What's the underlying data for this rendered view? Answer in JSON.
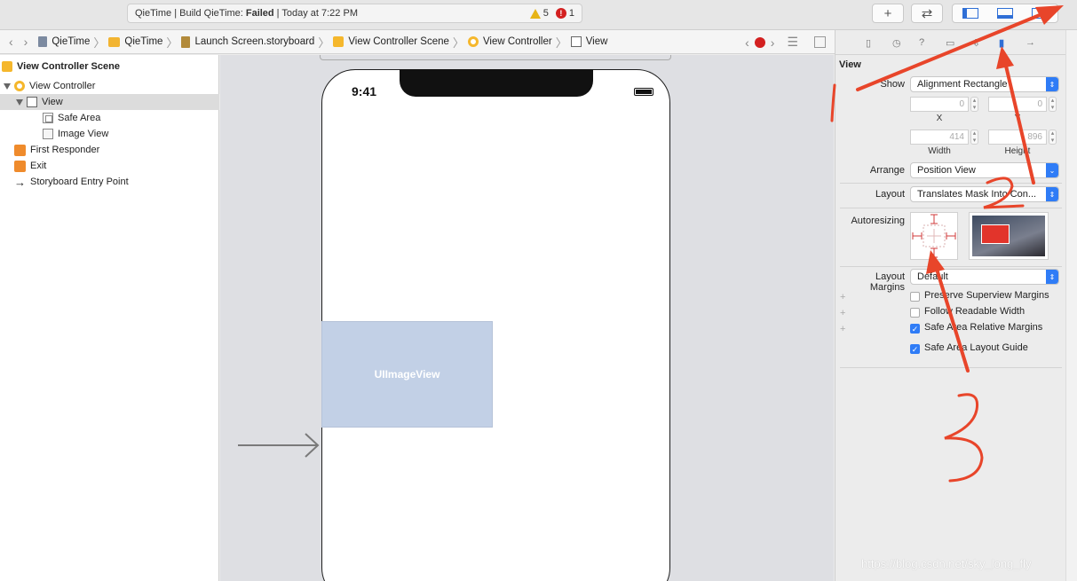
{
  "toolbar": {
    "status_prefix": "QieTime | Build QieTime:",
    "status_state": "Failed",
    "status_suffix": "| Today at 7:22 PM",
    "warning_count": "5",
    "error_count": "1",
    "add_label": "+",
    "swap_label": "⇄"
  },
  "jumpbar": {
    "crumbs": [
      "QieTime",
      "QieTime",
      "Launch Screen.storyboard",
      "View Controller Scene",
      "View Controller",
      "View"
    ]
  },
  "outline": {
    "scene": "View Controller Scene",
    "items": [
      "View Controller",
      "View",
      "Safe Area",
      "Image View",
      "First Responder",
      "Exit",
      "Storyboard Entry Point"
    ]
  },
  "canvas": {
    "time": "9:41",
    "image_view_label": "UIImageView"
  },
  "inspector": {
    "section": "View",
    "show_label": "Show",
    "show_value": "Alignment Rectangle",
    "x_value": "0",
    "y_value": "0",
    "x_label": "X",
    "y_label": "Y",
    "width_value": "414",
    "height_value": "896",
    "width_label": "Width",
    "height_label": "Height",
    "arrange_label": "Arrange",
    "arrange_value": "Position View",
    "layout_label": "Layout",
    "layout_value": "Translates Mask Into Con...",
    "autoresizing_label": "Autoresizing",
    "margins_label": "Layout Margins",
    "margins_value": "Default",
    "checks": [
      {
        "label": "Preserve Superview Margins",
        "checked": false
      },
      {
        "label": "Follow Readable Width",
        "checked": false
      },
      {
        "label": "Safe Area Relative Margins",
        "checked": true
      },
      {
        "label": "Safe Area Layout Guide",
        "checked": true
      }
    ]
  },
  "watermark": "https://blog.csdn.net/sky_long_fly",
  "annotation_color": "#e8452a"
}
